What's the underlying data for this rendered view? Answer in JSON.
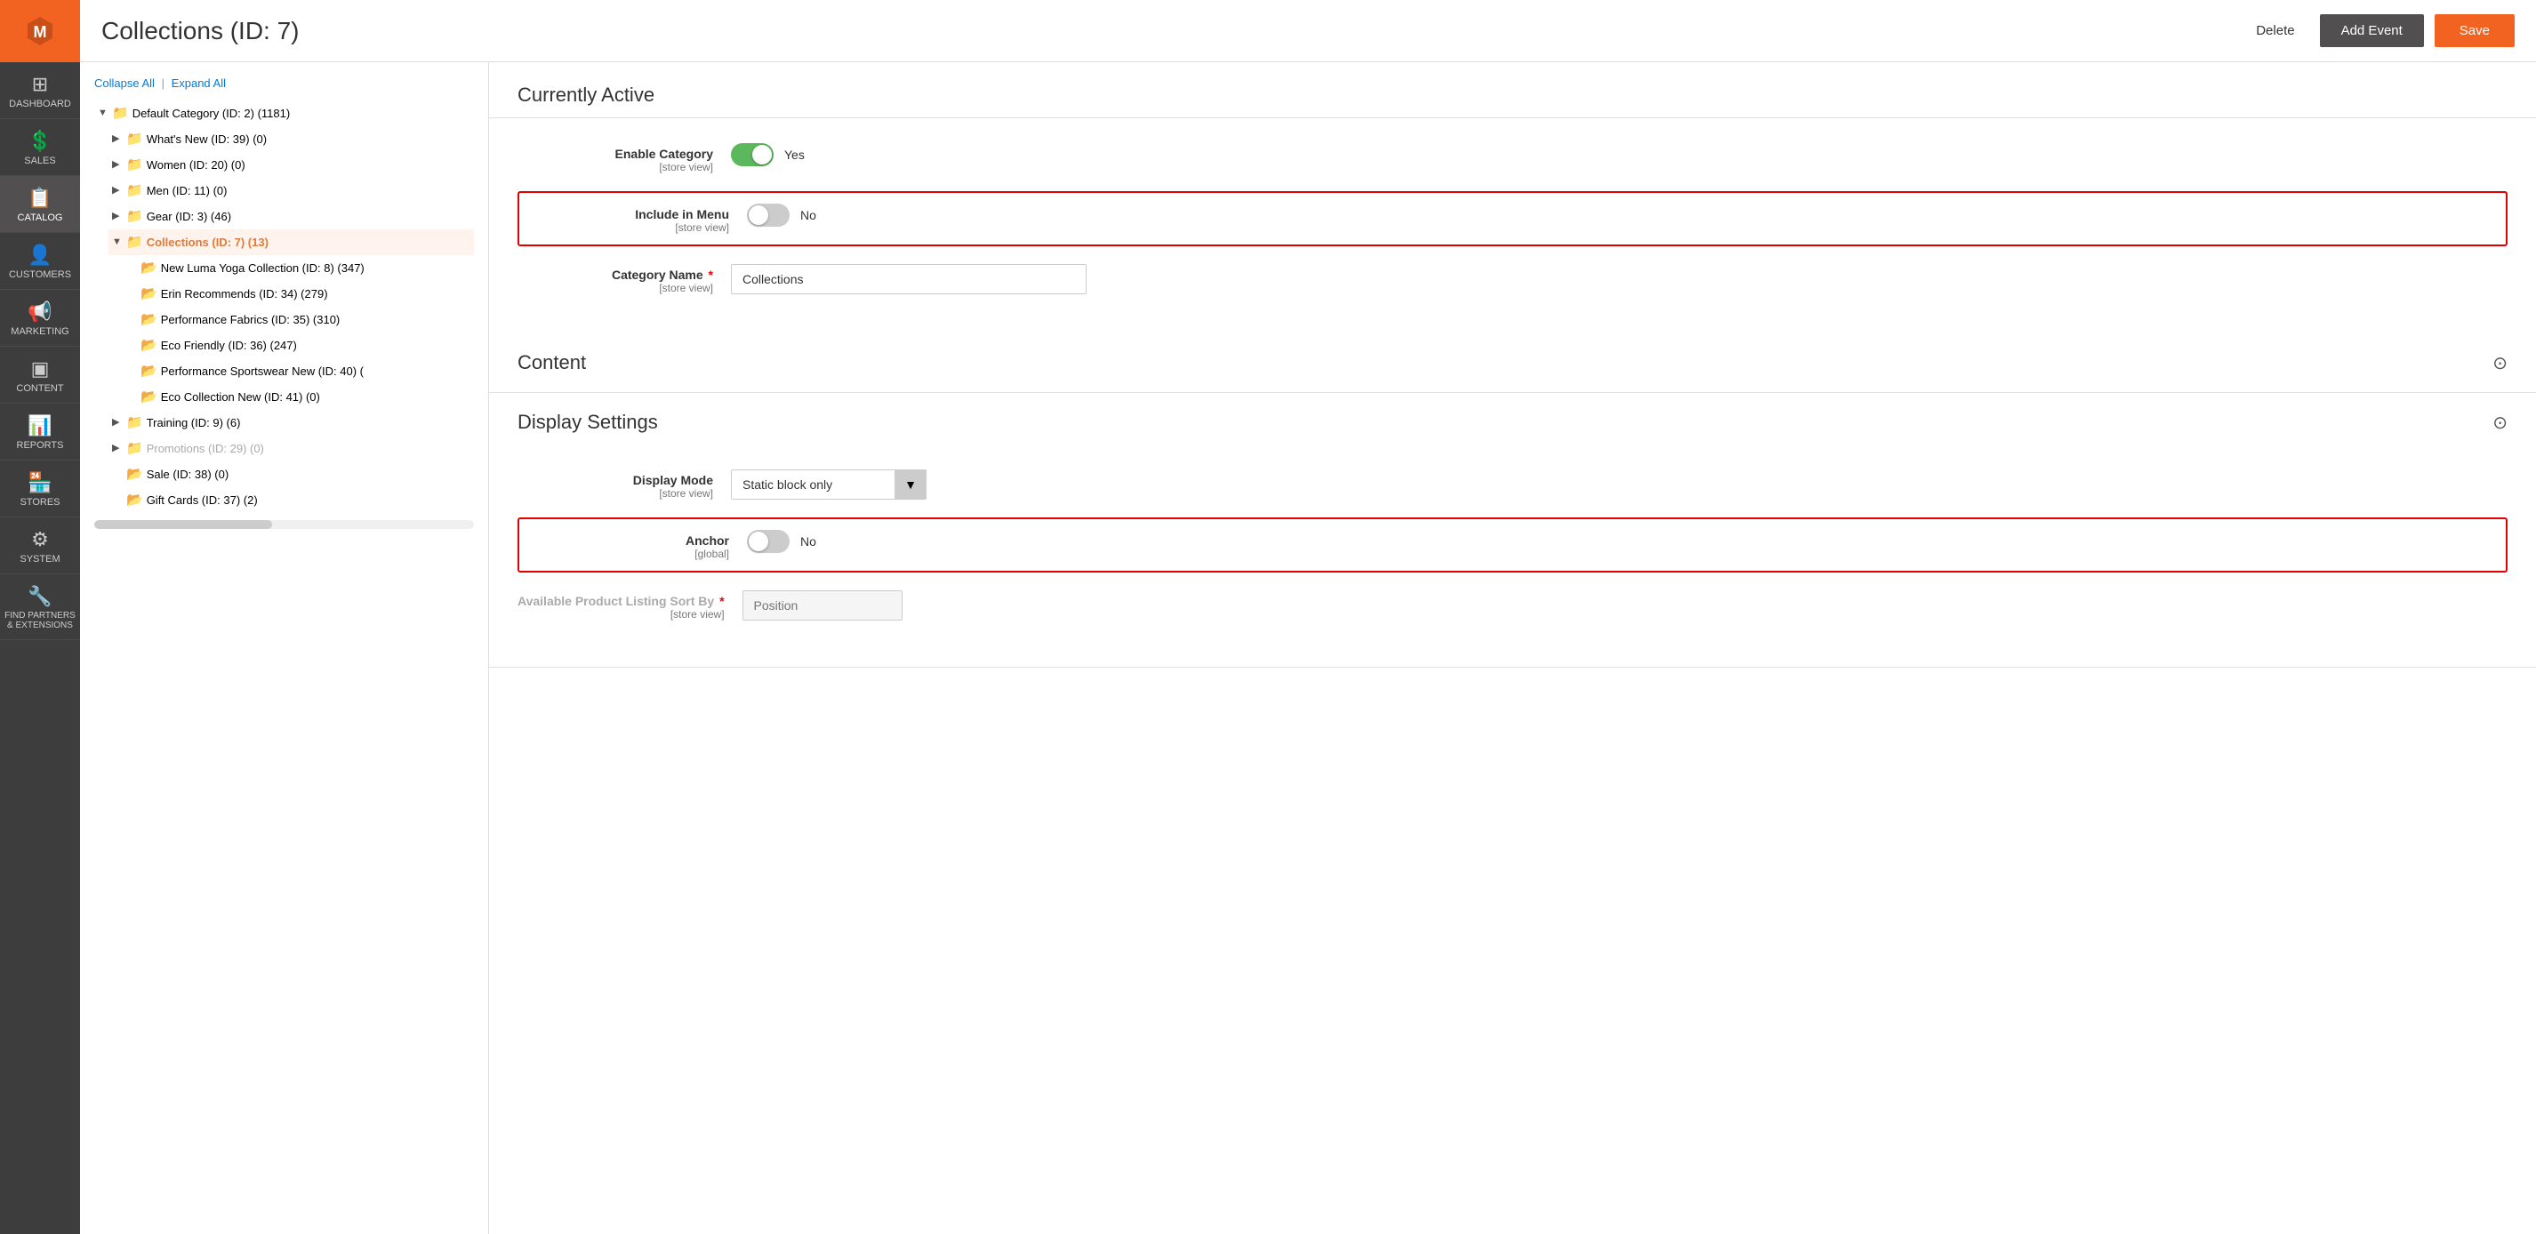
{
  "sidebar": {
    "logo_alt": "Magento Logo",
    "items": [
      {
        "id": "dashboard",
        "label": "DASHBOARD",
        "icon": "⊞",
        "active": false
      },
      {
        "id": "sales",
        "label": "SALES",
        "icon": "$",
        "active": false
      },
      {
        "id": "catalog",
        "label": "CATALOG",
        "icon": "📋",
        "active": true
      },
      {
        "id": "customers",
        "label": "CUSTOMERS",
        "icon": "👤",
        "active": false
      },
      {
        "id": "marketing",
        "label": "MARKETING",
        "icon": "📢",
        "active": false
      },
      {
        "id": "content",
        "label": "CONTENT",
        "icon": "▣",
        "active": false
      },
      {
        "id": "reports",
        "label": "REPORTS",
        "icon": "📊",
        "active": false
      },
      {
        "id": "stores",
        "label": "STORES",
        "icon": "🏪",
        "active": false
      },
      {
        "id": "system",
        "label": "SYSTEM",
        "icon": "⚙",
        "active": false
      },
      {
        "id": "find-partners",
        "label": "FIND PARTNERS & EXTENSIONS",
        "icon": "🔧",
        "active": false
      }
    ]
  },
  "header": {
    "title": "Collections (ID: 7)",
    "btn_delete": "Delete",
    "btn_add_event": "Add Event",
    "btn_save": "Save"
  },
  "tree": {
    "collapse_all": "Collapse All",
    "expand_all": "Expand All",
    "nodes": [
      {
        "id": "root",
        "label": "Default Category (ID: 2) (1181)",
        "level": 0,
        "expanded": true,
        "icon": "orange",
        "selected": false
      },
      {
        "id": "whats-new",
        "label": "What's New (ID: 39) (0)",
        "level": 1,
        "expanded": false,
        "icon": "orange",
        "selected": false
      },
      {
        "id": "women",
        "label": "Women (ID: 20) (0)",
        "level": 1,
        "expanded": false,
        "icon": "orange",
        "selected": false
      },
      {
        "id": "men",
        "label": "Men (ID: 11) (0)",
        "level": 1,
        "expanded": false,
        "icon": "orange",
        "selected": false
      },
      {
        "id": "gear",
        "label": "Gear (ID: 3) (46)",
        "level": 1,
        "expanded": false,
        "icon": "orange",
        "selected": false
      },
      {
        "id": "collections",
        "label": "Collections (ID: 7) (13)",
        "level": 1,
        "expanded": true,
        "icon": "orange",
        "selected": true
      },
      {
        "id": "new-luma",
        "label": "New Luma Yoga Collection (ID: 8) (347)",
        "level": 2,
        "expanded": false,
        "icon": "folder",
        "selected": false
      },
      {
        "id": "erin",
        "label": "Erin Recommends (ID: 34) (279)",
        "level": 2,
        "expanded": false,
        "icon": "folder",
        "selected": false
      },
      {
        "id": "performance-fabrics",
        "label": "Performance Fabrics (ID: 35) (310)",
        "level": 2,
        "expanded": false,
        "icon": "folder",
        "selected": false
      },
      {
        "id": "eco-friendly",
        "label": "Eco Friendly (ID: 36) (247)",
        "level": 2,
        "expanded": false,
        "icon": "folder",
        "selected": false
      },
      {
        "id": "performance-sportswear",
        "label": "Performance Sportswear New (ID: 40) (",
        "level": 2,
        "expanded": false,
        "icon": "folder",
        "selected": false
      },
      {
        "id": "eco-collection-new",
        "label": "Eco Collection New (ID: 41) (0)",
        "level": 2,
        "expanded": false,
        "icon": "folder",
        "selected": false
      },
      {
        "id": "training",
        "label": "Training (ID: 9) (6)",
        "level": 1,
        "expanded": false,
        "icon": "orange",
        "selected": false
      },
      {
        "id": "promotions",
        "label": "Promotions (ID: 29) (0)",
        "level": 1,
        "expanded": false,
        "icon": "gray",
        "selected": false
      },
      {
        "id": "sale",
        "label": "Sale (ID: 38) (0)",
        "level": 1,
        "expanded": false,
        "icon": "folder",
        "selected": false
      },
      {
        "id": "gift-cards",
        "label": "Gift Cards (ID: 37) (2)",
        "level": 1,
        "expanded": false,
        "icon": "folder",
        "selected": false
      }
    ]
  },
  "form": {
    "currently_active_title": "Currently Active",
    "enable_category_label": "Enable Category",
    "enable_category_sublabel": "[store view]",
    "enable_category_value": true,
    "enable_category_text_on": "Yes",
    "include_in_menu_label": "Include in Menu",
    "include_in_menu_sublabel": "[store view]",
    "include_in_menu_value": false,
    "include_in_menu_text_off": "No",
    "category_name_label": "Category Name",
    "category_name_sublabel": "[store view]",
    "category_name_required": true,
    "category_name_value": "Collections",
    "content_section_title": "Content",
    "display_settings_title": "Display Settings",
    "display_mode_label": "Display Mode",
    "display_mode_sublabel": "[store view]",
    "display_mode_value": "Static block only",
    "anchor_label": "Anchor",
    "anchor_sublabel": "[global]",
    "anchor_value": false,
    "anchor_text_off": "No",
    "available_sort_label": "Available Product Listing Sort By",
    "available_sort_sublabel": "[store view]",
    "available_sort_required": true,
    "available_sort_placeholder": "Position"
  }
}
